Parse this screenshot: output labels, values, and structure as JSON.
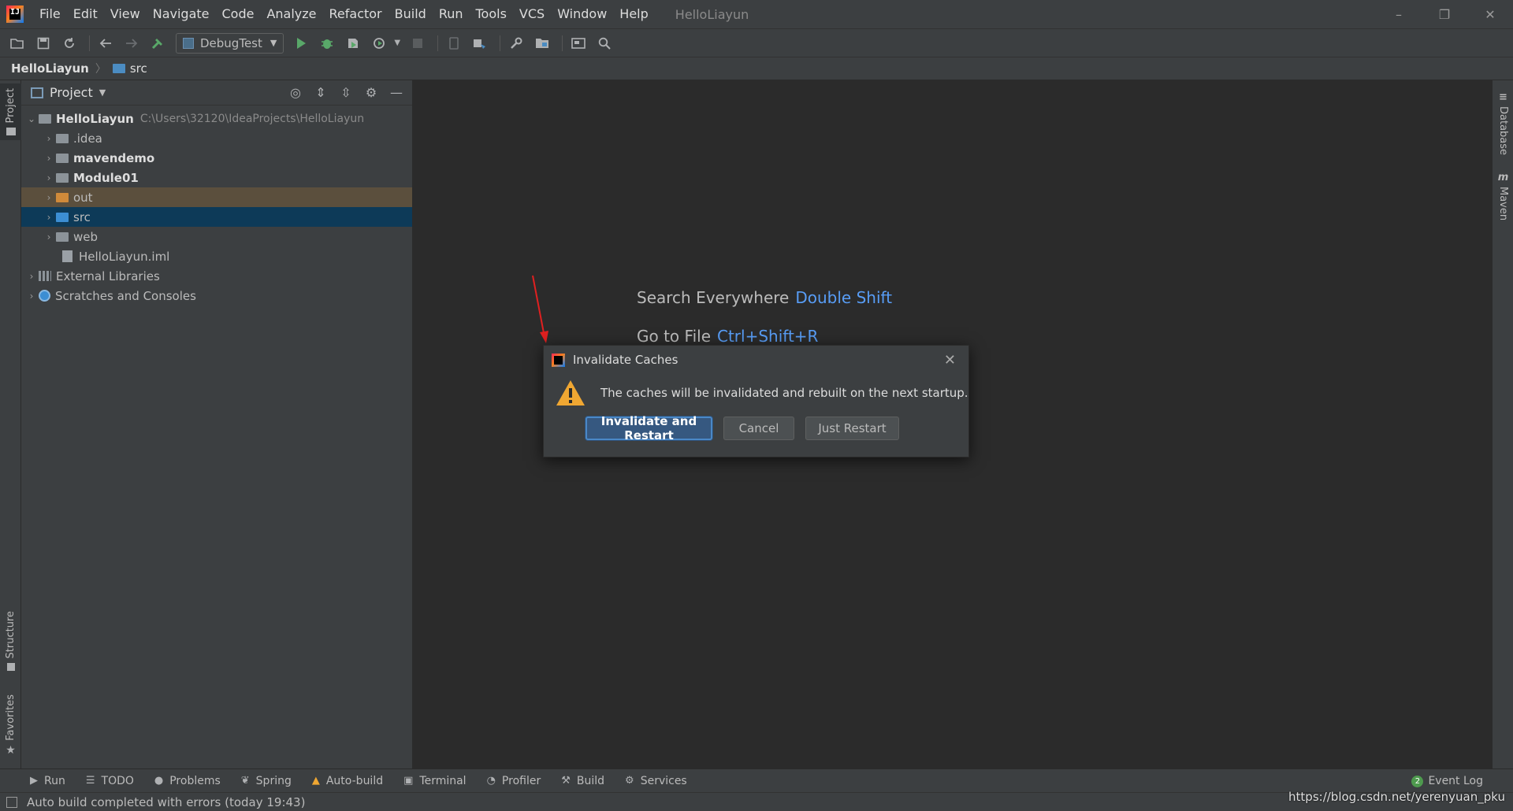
{
  "app": {
    "window_title": "HelloLiayun",
    "logo_text": "IJ"
  },
  "menu": {
    "items": [
      "File",
      "Edit",
      "View",
      "Navigate",
      "Code",
      "Analyze",
      "Refactor",
      "Build",
      "Run",
      "Tools",
      "VCS",
      "Window",
      "Help"
    ]
  },
  "window_controls": {
    "minimize": "–",
    "restore": "❐",
    "close": "✕"
  },
  "toolbar": {
    "run_config": "DebugTest",
    "icons": [
      "open-folder-icon",
      "save-icon",
      "sync-icon",
      "back-icon",
      "forward-icon",
      "build-hammer-icon",
      "run-icon",
      "debug-icon",
      "coverage-icon",
      "profile-icon",
      "stop-icon",
      "device-icon",
      "sdk-icon",
      "settings-wrench-icon",
      "project-structure-icon",
      "frame-icon",
      "search-icon"
    ]
  },
  "breadcrumb": {
    "root": "HelloLiayun",
    "current": "src"
  },
  "left_strip": {
    "project": "Project",
    "structure": "Structure",
    "favorites": "Favorites"
  },
  "project_panel": {
    "title": "Project",
    "tree": {
      "root_name": "HelloLiayun",
      "root_path": "C:\\Users\\32120\\IdeaProjects\\HelloLiayun",
      "idea": ".idea",
      "mavendemo": "mavendemo",
      "module01": "Module01",
      "out": "out",
      "src": "src",
      "web": "web",
      "iml": "HelloLiayun.iml",
      "external_libraries": "External Libraries",
      "scratches": "Scratches and Consoles"
    }
  },
  "editor": {
    "hint_search_label": "Search Everywhere",
    "hint_search_key": "Double Shift",
    "hint_goto_label": "Go to File",
    "hint_goto_key": "Ctrl+Shift+R"
  },
  "right_strip": {
    "database": "Database",
    "maven": "Maven",
    "maven_icon": "m"
  },
  "dialog": {
    "title": "Invalidate Caches",
    "close": "✕",
    "message": "The caches will be invalidated and rebuilt on the next startup.",
    "btn_invalidate": "Invalidate and Restart",
    "btn_cancel": "Cancel",
    "btn_just_restart": "Just Restart"
  },
  "bottom_tabs": [
    {
      "label": "Run",
      "icon": "▶"
    },
    {
      "label": "TODO",
      "icon": "☰"
    },
    {
      "label": "Problems",
      "icon": "●"
    },
    {
      "label": "Spring",
      "icon": "❦"
    },
    {
      "label": "Auto-build",
      "icon": "▲"
    },
    {
      "label": "Terminal",
      "icon": "▣"
    },
    {
      "label": "Profiler",
      "icon": "◔"
    },
    {
      "label": "Build",
      "icon": "⚒"
    },
    {
      "label": "Services",
      "icon": "⚙"
    }
  ],
  "event_log": {
    "count": "2",
    "label": "Event Log"
  },
  "status": {
    "text": "Auto build completed with errors (today 19:43)"
  },
  "watermark": "https://blog.csdn.net/yerenyuan_pku",
  "colors": {
    "accent": "#589df6",
    "selection_src": "#0d3a58",
    "selection_out": "#5b4f3d",
    "primary_button": "#365880"
  }
}
